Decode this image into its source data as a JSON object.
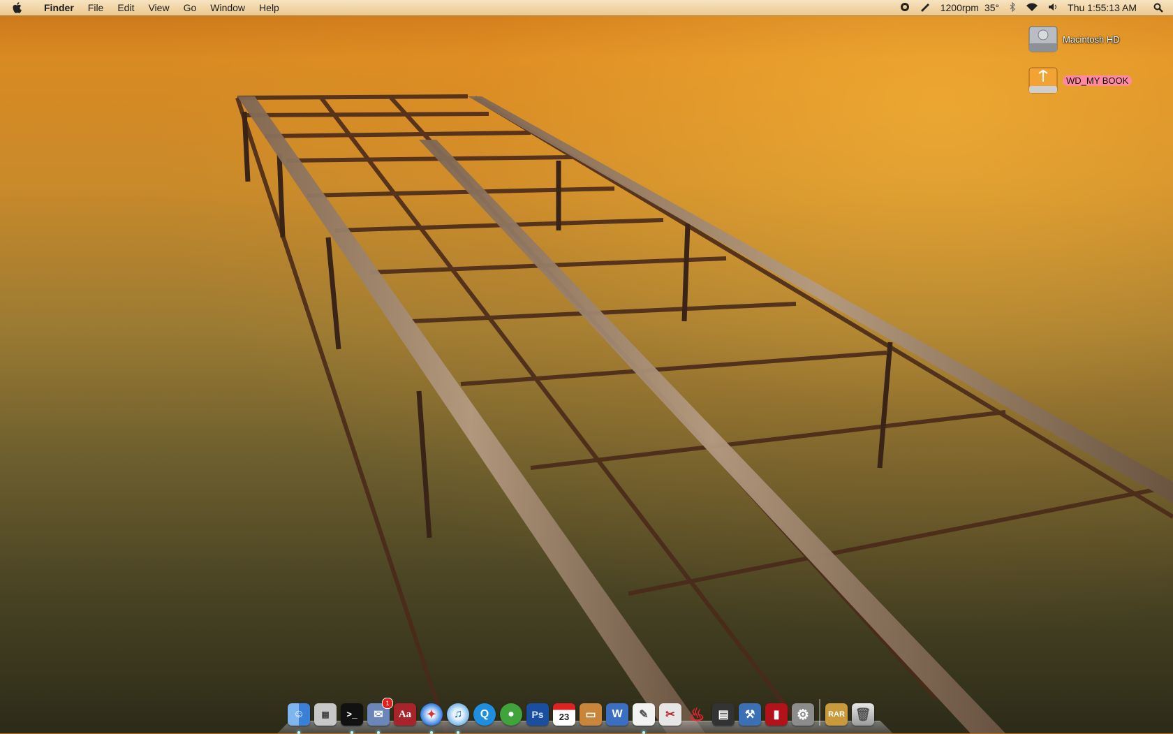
{
  "menubar": {
    "app_name": "Finder",
    "menus": [
      "File",
      "Edit",
      "View",
      "Go",
      "Window",
      "Help"
    ],
    "status": {
      "fan_speed": "1200rpm",
      "temperature": "35°",
      "clock": "Thu 1:55:13 AM"
    }
  },
  "desktop": {
    "icons": [
      {
        "label": "Macintosh HD",
        "icon": "hard-drive-icon",
        "selected": false
      },
      {
        "label": "WD_MY BOOK",
        "icon": "firewire-drive-icon",
        "selected": true
      }
    ]
  },
  "dock": {
    "items": [
      {
        "name": "finder",
        "icon": "finder-icon",
        "running": true
      },
      {
        "name": "calculator",
        "icon": "calculator-icon",
        "running": false
      },
      {
        "name": "terminal",
        "icon": "terminal-icon",
        "running": true
      },
      {
        "name": "mail-stamp",
        "icon": "mail-icon",
        "running": true,
        "badge": "1"
      },
      {
        "name": "dictionary",
        "icon": "dictionary-icon",
        "running": false
      },
      {
        "name": "safari",
        "icon": "safari-icon",
        "running": true
      },
      {
        "name": "itunes",
        "icon": "itunes-icon",
        "running": true
      },
      {
        "name": "quicktime",
        "icon": "quicktime-icon",
        "running": false
      },
      {
        "name": "adium",
        "icon": "adium-duck-icon",
        "running": false
      },
      {
        "name": "photoshop",
        "icon": "photoshop-icon",
        "running": false
      },
      {
        "name": "ical",
        "icon": "calendar-icon",
        "running": false,
        "date": "23"
      },
      {
        "name": "keynote",
        "icon": "keynote-icon",
        "running": false
      },
      {
        "name": "word",
        "icon": "word-icon",
        "running": false
      },
      {
        "name": "textedit",
        "icon": "textedit-icon",
        "running": true
      },
      {
        "name": "script-editor",
        "icon": "script-icon",
        "running": false
      },
      {
        "name": "flash",
        "icon": "flame-icon",
        "running": false
      },
      {
        "name": "itunes-player",
        "icon": "player-icon",
        "running": false
      },
      {
        "name": "xcode",
        "icon": "xcode-icon",
        "running": false
      },
      {
        "name": "photo-booth",
        "icon": "photo-booth-icon",
        "running": false
      },
      {
        "name": "system-preferences",
        "icon": "gear-icon",
        "running": false
      },
      {
        "name": "rar-archiver",
        "icon": "archive-icon",
        "running": false
      },
      {
        "name": "trash",
        "icon": "trash-icon",
        "running": false
      }
    ],
    "separator_after_index": 19,
    "colors": {
      "finder": "#3a7fd8",
      "photoshop": "#1a4fa0",
      "dictionary": "#a8242a",
      "terminal": "#111111"
    }
  }
}
